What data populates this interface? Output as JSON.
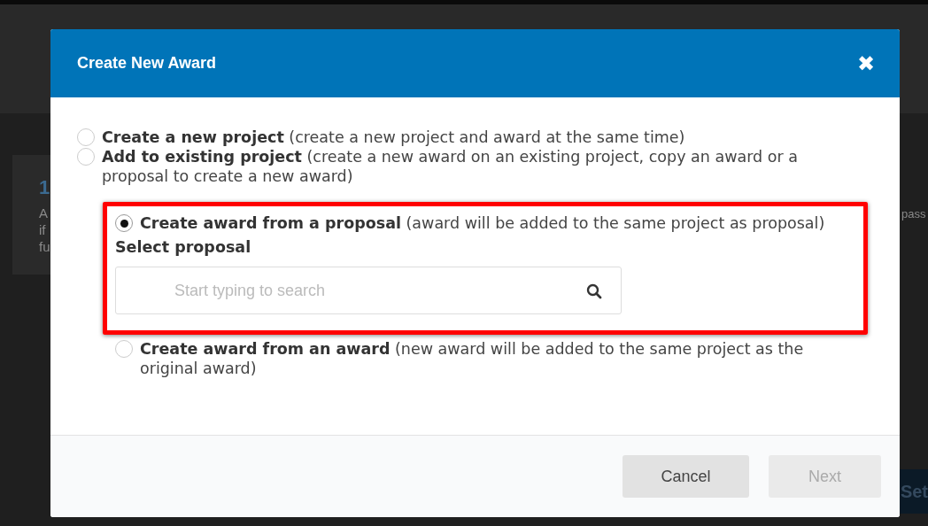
{
  "background": {
    "card_texts": [
      "1",
      "A",
      "if",
      "fu"
    ],
    "side_text": "pass",
    "button": "Set"
  },
  "dialog": {
    "title": "Create New Award",
    "close": "✖",
    "options": [
      {
        "label": "**Create a new project** (create a new project and award at the same time)",
        "selected": false
      },
      {
        "label": "**Add to existing project** (create a new award on an existing project, copy an award or a proposal to create a new award)",
        "selected": false,
        "children": [
          {
            "label": "**Create award from a proposal** (award will be added to the same project as proposal)",
            "selected": true,
            "highlighted": true,
            "field": {
              "label": "Select proposal",
              "placeholder": "Start typing to search"
            }
          },
          {
            "label": "**Create award from an award** (new award will be added to the same project as the original award)",
            "selected": false,
            "highlighted": false
          }
        ]
      }
    ],
    "buttons": [
      {
        "label": "Cancel",
        "disabled": false
      },
      {
        "label": "Next",
        "disabled": true
      }
    ]
  }
}
